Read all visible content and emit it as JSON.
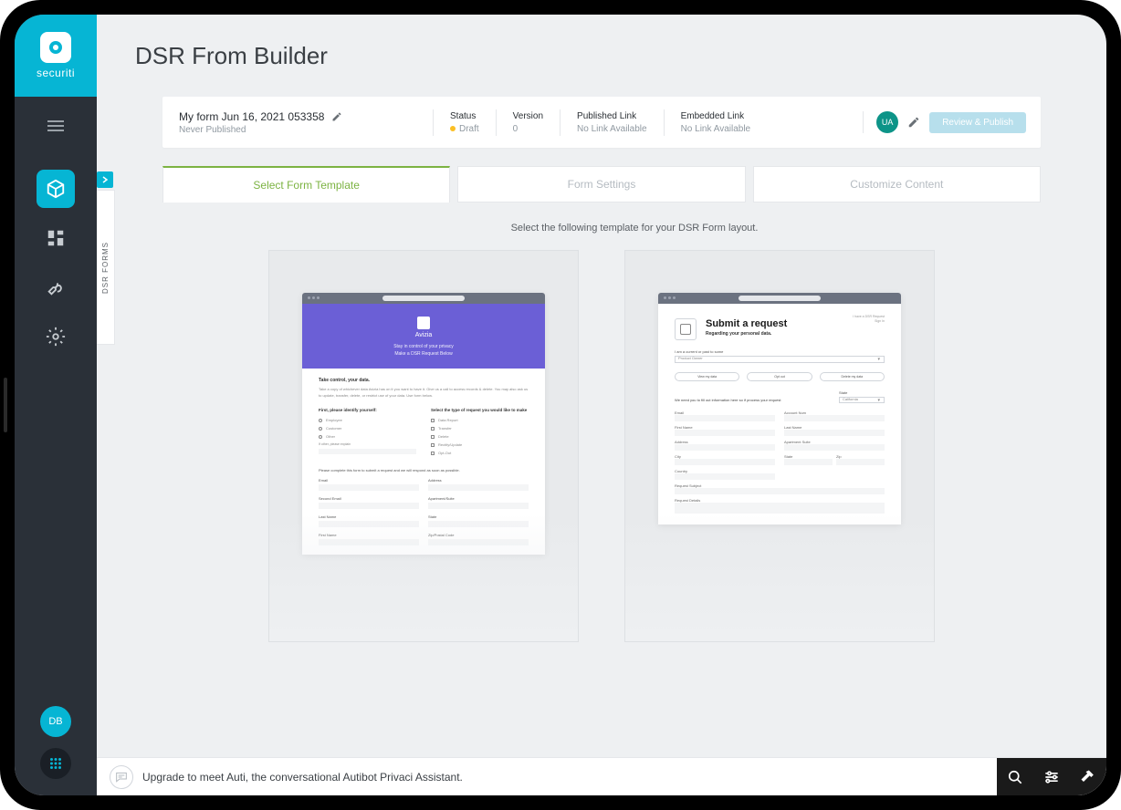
{
  "brand": {
    "name": "securiti"
  },
  "sidebar": {
    "avatar": "DB"
  },
  "page": {
    "title": "DSR From Builder"
  },
  "dsr_rail": {
    "label": "DSR FORMS"
  },
  "info": {
    "form_name": "My form Jun 16, 2021 053358",
    "publish_sub": "Never Published",
    "status": {
      "label": "Status",
      "value": "Draft"
    },
    "version": {
      "label": "Version",
      "value": "0"
    },
    "published_link": {
      "label": "Published Link",
      "value": "No Link Available"
    },
    "embedded_link": {
      "label": "Embedded Link",
      "value": "No Link Available"
    },
    "user_badge": "UA",
    "review_btn": "Review & Publish"
  },
  "tabs": {
    "select": "Select Form Template",
    "settings": "Form Settings",
    "customize": "Customize Content"
  },
  "instruction": "Select the following template for your DSR Form layout.",
  "template1": {
    "brand": "Avizia",
    "tag1": "Stay in control of your privacy",
    "tag2": "Make a DSR Request Below",
    "heading": "Take control, your data.",
    "para": "Take a copy of whichever data Avizia has on it you want to have it. Give us a call to access records & delete. You may also ask us to update, transfer, delete, or restrict use of your data. Use form below.",
    "identify_h": "First, please identify yourself:",
    "opt_employee": "Employee",
    "opt_customer": "Customer",
    "opt_other": "Other",
    "other_placeholder": "If other, please explain",
    "request_h": "Select the type of request you would like to make",
    "cb_report": "Data Report",
    "cb_transfer": "Transfer",
    "cb_delete": "Delete",
    "cb_rectify": "Rectify/Update",
    "cb_optout": "Opt-Out",
    "form_note": "Please complete this form to submit a request and we will respond as soon as possible.",
    "f_email": "Email",
    "f_address": "Address",
    "f_secondemail": "Second Email",
    "f_aptsuite": "Apartment/Suite",
    "f_lastname": "Last Name",
    "f_state": "State",
    "f_firstname": "First Name",
    "f_zip": "Zip/Postal Code"
  },
  "template2": {
    "topright1": "I have a DSR Request",
    "topright2": "Sign In",
    "title": "Submit a request",
    "sub": "Regarding your personal data.",
    "iam_label": "I am a current or past to some",
    "iam_value": "Product Owner",
    "btn_view": "View my data",
    "btn_optout": "Opt out",
    "btn_delete": "Delete my data",
    "note": "We need you to fill out information here so if process your request",
    "state_label": "State",
    "state_value": "California",
    "f_email": "Email",
    "f_accountnum": "Account Num",
    "f_firstname": "First Name",
    "f_lastname": "Last Name",
    "f_address": "Address",
    "f_aptsuite": "Apartment Suite",
    "f_city": "City",
    "f_state": "State",
    "f_zip": "Zip",
    "f_country": "Country",
    "f_reqsubject": "Request Subject",
    "f_reqdetails": "Request Details"
  },
  "bottom": {
    "text": "Upgrade to meet Auti, the conversational Autibot Privaci Assistant."
  }
}
